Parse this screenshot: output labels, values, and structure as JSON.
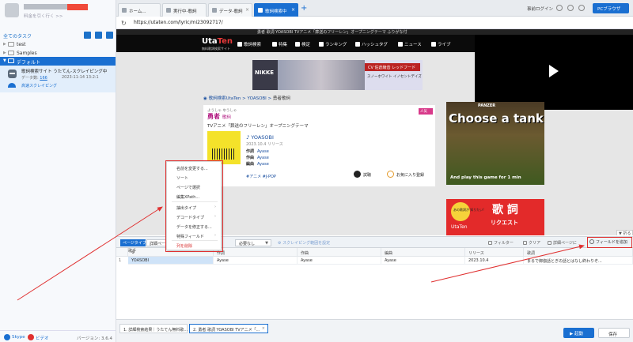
{
  "left": {
    "user_plan": "料金を引く行く >>",
    "tasks_header": "全てのタスク",
    "tree": [
      {
        "label": "test"
      },
      {
        "label": "Samples"
      },
      {
        "label": "デフォルト"
      }
    ],
    "task": {
      "title": "歌詞検索サイト うたてん-スクレイピング中",
      "count_label": "データ数:",
      "count_value": "166",
      "date": "2023-11-14 13:2:1",
      "status": "高速スクレイピング"
    },
    "footer": {
      "skype": "Skype",
      "video": "ビデオ",
      "version": "バージョン: 3.6.4"
    }
  },
  "browser": {
    "tabs": [
      {
        "label": "ホーム..."
      },
      {
        "label": "実行中-歌詞"
      },
      {
        "label": "データ-歌詞"
      },
      {
        "label": "歌詞検索中"
      }
    ],
    "login": "事前ログイン",
    "pc_button": "PCブラウザ",
    "url": "https://utaten.com/lyric/mi23092717/"
  },
  "site": {
    "title_bar": "勇者 歌詞 YOASOBI TVアニメ「葬送のフリーレン」オープニングテーマ ふりがな付",
    "logo_main": "Uta",
    "logo_accent": "Ten",
    "logo_sub": "無料歌詞検索サイト",
    "nav": [
      "歌詞検索",
      "特集",
      "検定",
      "ランキング",
      "ハッシュタグ",
      "ニュース",
      "ライブ"
    ],
    "ad_top": {
      "brand": "NIKKE",
      "badge": "CV 佐倉綾音 レッドフード",
      "sub": "スノーホワイト イノセントデイズ"
    },
    "breadcrumb": {
      "home": "歌詞検索UtaTen",
      "artist": "YOASOBI",
      "current": "勇者歌詞"
    },
    "song": {
      "kana": "ようしゃ ゆうしゃ",
      "title": "勇者",
      "title_suffix": "歌詞",
      "subtitle": "TVアニメ「葬送のフリーレン」オープニングテーマ",
      "badge": "人気",
      "artist": "YOASOBI",
      "release": "2023.10.4 リリース",
      "credits": [
        {
          "role": "作詞",
          "name": "Ayase"
        },
        {
          "role": "作曲",
          "name": "Ayase"
        },
        {
          "role": "編曲",
          "name": "Ayase"
        }
      ],
      "tags": "#アニメ #J-POP",
      "listen": "試聴",
      "fav": "お気に入り登録"
    },
    "ad_tank": {
      "brand": "PANZER",
      "headline": "Choose a tank",
      "tagline": "And play this game for 1 min"
    },
    "ad_lyric": {
      "bubble": "あの歌詞が 知りたい!",
      "big": "歌 詞",
      "req": "リクエスト",
      "brand": "UtaTen"
    },
    "collapse": "折る"
  },
  "context_menu": {
    "items": [
      {
        "label": "名前を変更する..."
      },
      {
        "label": "ソート"
      },
      {
        "label": "ページで選択"
      },
      {
        "label": "編集XPath..."
      },
      {
        "label": "抽出タイプ"
      },
      {
        "label": "デコードタイプ"
      },
      {
        "label": "データを修正する..."
      },
      {
        "label": "特殊フィールド"
      },
      {
        "label": "列を削除"
      }
    ]
  },
  "data_panel": {
    "list_view": "ページタイプ",
    "detail_view": "詳細ペー",
    "select_value": "必要なし",
    "scroll_settings": "スクレイピング範囲を設定",
    "filter": "フィルター",
    "clear": "クリア",
    "detail_page": "詳細ページに",
    "add_field": "フィールドを追加",
    "columns": [
      "歌手",
      "作詞",
      "作曲",
      "編曲",
      "リリース",
      "歌詞"
    ],
    "rows": [
      {
        "num": "1",
        "cells": [
          "YOASOBI",
          "Ayase",
          "Ayase",
          "Ayase",
          "2023.10.4",
          "まるで御伽話とぎの話とはなし終わりぞ..."
        ]
      }
    ]
  },
  "bottom": {
    "tabs": [
      {
        "label": "1. 詳細検索結果｜うたてん無料歌..."
      },
      {
        "label": "2. 勇者 歌詞 YOASOBI TVアニメ「..."
      }
    ],
    "start": "▶ 起動",
    "save": "保存"
  }
}
